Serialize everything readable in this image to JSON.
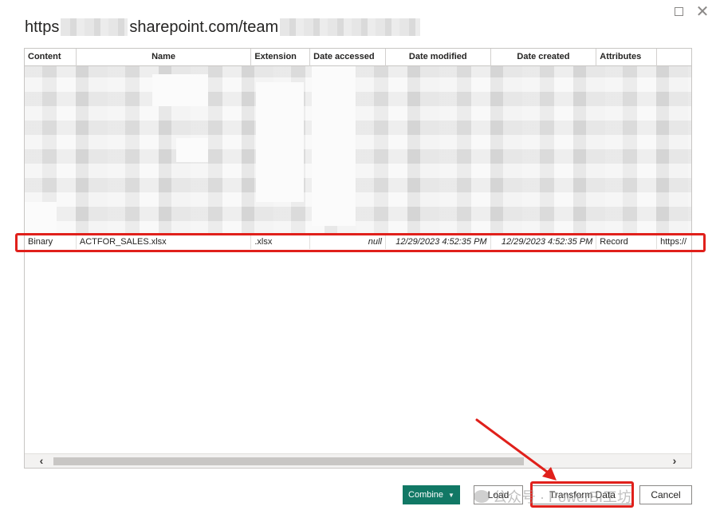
{
  "dialog": {
    "title_prefix": "https",
    "title_mid": "sharepoint.com/team"
  },
  "table": {
    "columns": [
      "Content",
      "Name",
      "Extension",
      "Date accessed",
      "Date modified",
      "Date created",
      "Attributes",
      ""
    ],
    "visible_row": {
      "content": "Binary",
      "name": "ACTFOR_SALES.xlsx",
      "extension": ".xlsx",
      "date_accessed": "null",
      "date_modified": "12/29/2023 4:52:35 PM",
      "date_created": "12/29/2023 4:52:35 PM",
      "attributes": "Record",
      "folder_path": "https://"
    }
  },
  "buttons": {
    "combine": "Combine",
    "load": "Load",
    "transform": "Transform Data",
    "cancel": "Cancel"
  },
  "watermark": "公众号 · PowerBI工坊",
  "colors": {
    "highlight": "#e0201b",
    "primary_button": "#117865"
  },
  "icons": {
    "maximize": "maximize-icon",
    "close": "close-icon",
    "scroll_left": "chevron-left-icon",
    "scroll_right": "chevron-right-icon",
    "combine_dropdown": "caret-down-icon"
  }
}
